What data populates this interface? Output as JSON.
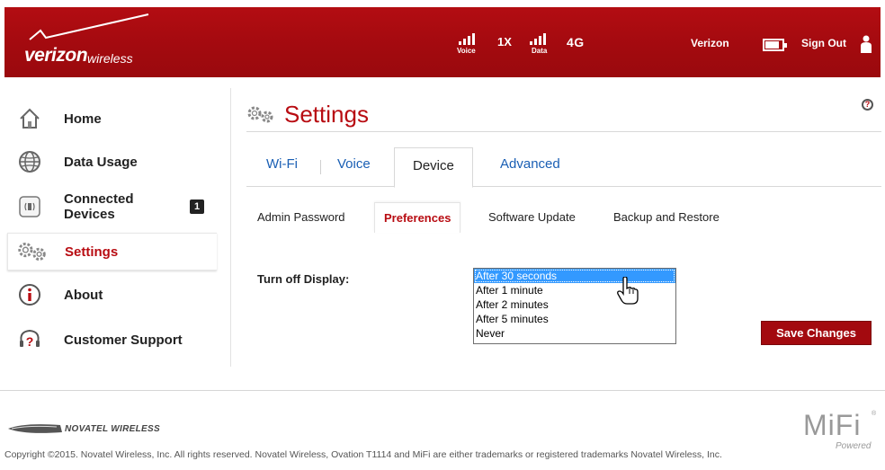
{
  "header": {
    "brand": "verizon",
    "brand_suffix": "wireless",
    "voice_label": "Voice",
    "network_1x": "1X",
    "data_label": "Data",
    "network_4g": "4G",
    "carrier": "Verizon",
    "battery_level": 0.85,
    "sign_out": "Sign Out"
  },
  "sidebar": {
    "items": [
      {
        "label": "Home",
        "icon": "home-icon"
      },
      {
        "label": "Data Usage",
        "icon": "globe-icon"
      },
      {
        "label": "Connected Devices",
        "line1": "Connected",
        "line2": "Devices",
        "icon": "connected-devices-icon",
        "badge": "1"
      },
      {
        "label": "Settings",
        "icon": "gears-icon",
        "active": true
      },
      {
        "label": "About",
        "icon": "info-icon"
      },
      {
        "label": "Customer Support",
        "icon": "support-icon"
      }
    ]
  },
  "main": {
    "title": "Settings",
    "help_glyph": "?",
    "tabs": [
      {
        "label": "Wi-Fi"
      },
      {
        "label": "Voice"
      },
      {
        "label": "Device",
        "active": true
      },
      {
        "label": "Advanced"
      }
    ],
    "subtabs": [
      {
        "label": "Admin Password"
      },
      {
        "label": "Preferences",
        "active": true
      },
      {
        "label": "Software Update"
      },
      {
        "label": "Backup and Restore"
      }
    ],
    "display": {
      "label": "Turn off Display:",
      "options": [
        "After 30 seconds",
        "After 1 minute",
        "After 2 minutes",
        "After 5 minutes",
        "Never"
      ],
      "selected": "After 30 seconds"
    },
    "save_label": "Save Changes"
  },
  "footer": {
    "vendor": "NOVATEL WIRELESS",
    "product": "MiFi",
    "product_reg": "®",
    "powered": "Powered",
    "copyright": "Copyright ©2015. Novatel Wireless, Inc. All rights reserved. Novatel Wireless, Ovation T1114 and MiFi are either trademarks or registered trademarks Novatel Wireless, Inc."
  },
  "colors": {
    "brand_red": "#b80c12",
    "header_red": "#a30a0f",
    "link_blue": "#1a5fb4",
    "select_blue": "#3399ff"
  }
}
